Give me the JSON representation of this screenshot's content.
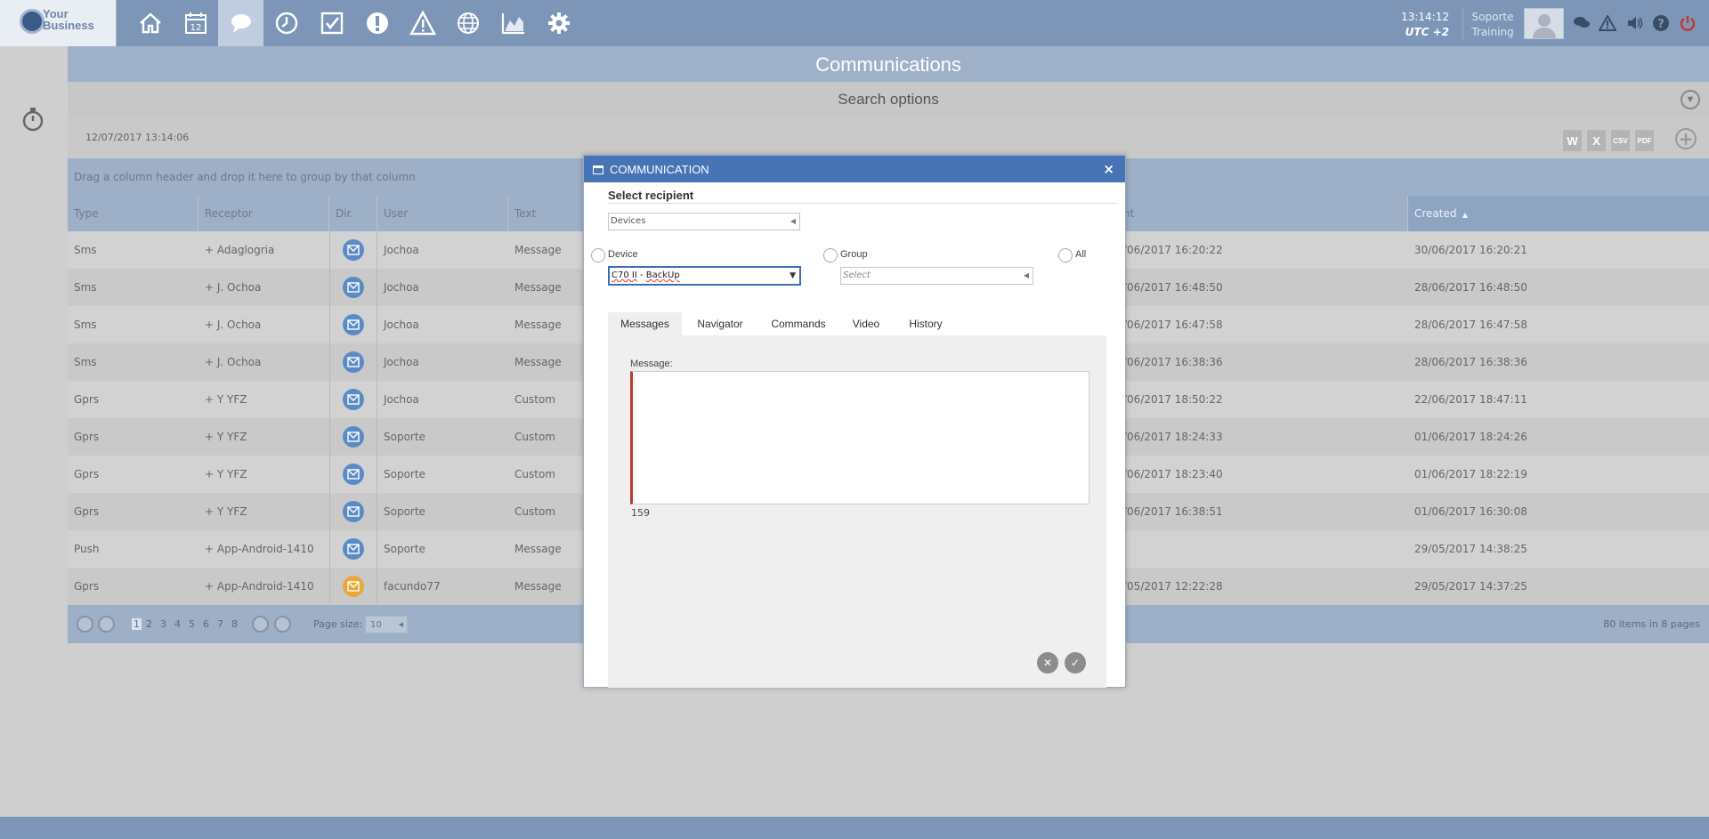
{
  "header": {
    "logo_text_line1": "Your",
    "logo_text_line2": "Business",
    "nav_icons": [
      "home-icon",
      "calendar-icon",
      "chat-icon",
      "clock-icon",
      "check-icon",
      "alert-icon",
      "warning-icon",
      "globe-icon",
      "chart-icon",
      "gear-icon"
    ],
    "calendar_day": "12",
    "time": "13:14:12",
    "timezone": "UTC +2",
    "user_line1": "Soporte",
    "user_line2": "Training"
  },
  "page": {
    "title": "Communications",
    "search_options": "Search options",
    "date": "12/07/2017 13:14:06",
    "export_labels": [
      "W",
      "X",
      "CSV",
      "PDF"
    ],
    "group_hint": "Drag a column header and drop it here to group by that column"
  },
  "grid": {
    "columns": {
      "type": "Type",
      "receptor": "Receptor",
      "dir": "Dir.",
      "user": "User",
      "text": "Text",
      "sent": "nt",
      "created": "Created"
    },
    "rows": [
      {
        "type": "Sms",
        "receptor": "+ Adaglogria",
        "user": "Jochoa",
        "text": "Message",
        "sent": "/06/2017 16:20:22",
        "created": "30/06/2017 16:20:21",
        "dir_color": "#5b8bc7"
      },
      {
        "type": "Sms",
        "receptor": "+ J. Ochoa",
        "user": "Jochoa",
        "text": "Message",
        "sent": "/06/2017 16:48:50",
        "created": "28/06/2017 16:48:50",
        "dir_color": "#5b8bc7"
      },
      {
        "type": "Sms",
        "receptor": "+ J. Ochoa",
        "user": "Jochoa",
        "text": "Message",
        "sent": "/06/2017 16:47:58",
        "created": "28/06/2017 16:47:58",
        "dir_color": "#5b8bc7"
      },
      {
        "type": "Sms",
        "receptor": "+ J. Ochoa",
        "user": "Jochoa",
        "text": "Message",
        "sent": "/06/2017 16:38:36",
        "created": "28/06/2017 16:38:36",
        "dir_color": "#5b8bc7"
      },
      {
        "type": "Gprs",
        "receptor": "+ Y YFZ",
        "user": "Jochoa",
        "text": "Custom",
        "sent": "/06/2017 18:50:22",
        "created": "22/06/2017 18:47:11",
        "dir_color": "#5b8bc7"
      },
      {
        "type": "Gprs",
        "receptor": "+ Y YFZ",
        "user": "Soporte",
        "text": "Custom",
        "sent": "/06/2017 18:24:33",
        "created": "01/06/2017 18:24:26",
        "dir_color": "#5b8bc7"
      },
      {
        "type": "Gprs",
        "receptor": "+ Y YFZ",
        "user": "Soporte",
        "text": "Custom",
        "sent": "/06/2017 18:23:40",
        "created": "01/06/2017 18:22:19",
        "dir_color": "#5b8bc7"
      },
      {
        "type": "Gprs",
        "receptor": "+ Y YFZ",
        "user": "Soporte",
        "text": "Custom",
        "sent": "/06/2017 16:38:51",
        "created": "01/06/2017 16:30:08",
        "dir_color": "#5b8bc7"
      },
      {
        "type": "Push",
        "receptor": "+ App-Android-1410",
        "user": "Soporte",
        "text": "Message",
        "sent": "",
        "created": "29/05/2017 14:38:25",
        "dir_color": "#5b8bc7"
      },
      {
        "type": "Gprs",
        "receptor": "+ App-Android-1410",
        "user": "facundo77",
        "text": "Message",
        "sent": "/05/2017 12:22:28",
        "created": "29/05/2017 14:37:25",
        "dir_color": "#e8a83a"
      }
    ]
  },
  "pager": {
    "pages": [
      "1",
      "2",
      "3",
      "4",
      "5",
      "6",
      "7",
      "8"
    ],
    "current_page": "1",
    "page_size_label": "Page size:",
    "page_size": "10",
    "summary": "80 items in 8 pages"
  },
  "dialog": {
    "title": "COMMUNICATION",
    "close": "×",
    "section": "Select recipient",
    "type_select": "Devices",
    "radio_device": "Device",
    "radio_group": "Group",
    "radio_all": "All",
    "device_value_part1": "C70 II",
    "device_value_sep": " - ",
    "device_value_part2": "BackUp",
    "group_placeholder": "Select",
    "tabs": [
      "Messages",
      "Navigator",
      "Commands",
      "Video",
      "History"
    ],
    "message_label": "Message:",
    "char_count": "159"
  },
  "colors": {
    "topbar": "#7d96b7",
    "dialog_header": "#4774b5",
    "dir_blue": "#5b8bc7",
    "dir_orange": "#e8a83a"
  }
}
